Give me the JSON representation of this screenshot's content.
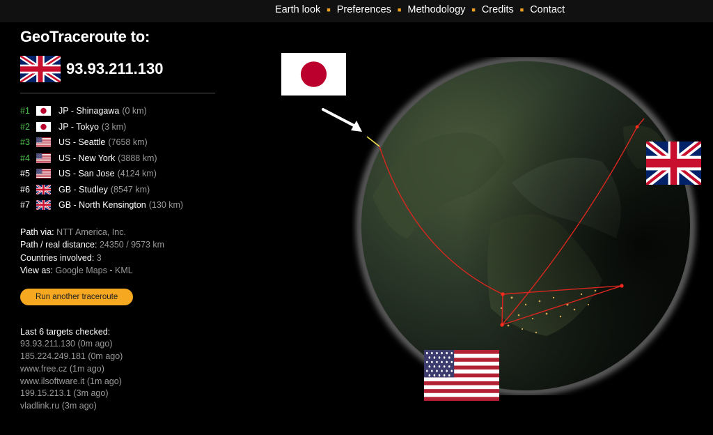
{
  "nav": {
    "items": [
      "Earth look",
      "Preferences",
      "Methodology",
      "Credits",
      "Contact"
    ],
    "separator_color": "#f0a01e"
  },
  "panel": {
    "title": "GeoTraceroute to:",
    "target_ip": "93.93.211.130",
    "target_flag": "gb-flag"
  },
  "hops": [
    {
      "num": "#1",
      "flag": "jp-flag",
      "label": "JP - Shinagawa",
      "dist": "(0 km)",
      "color": "green"
    },
    {
      "num": "#2",
      "flag": "jp-flag",
      "label": "JP - Tokyo",
      "dist": "(3 km)",
      "color": "green"
    },
    {
      "num": "#3",
      "flag": "us-flag",
      "label": "US - Seattle",
      "dist": "(7658 km)",
      "color": "green"
    },
    {
      "num": "#4",
      "flag": "us-flag",
      "label": "US - New York",
      "dist": "(3888 km)",
      "color": "green"
    },
    {
      "num": "#5",
      "flag": "us-flag",
      "label": "US - San Jose",
      "dist": "(4124 km)",
      "color": "white"
    },
    {
      "num": "#6",
      "flag": "gb-flag",
      "label": "GB - Studley",
      "dist": "(8547 km)",
      "color": "white"
    },
    {
      "num": "#7",
      "flag": "gb-flag",
      "label": "GB - North Kensington",
      "dist": "(130 km)",
      "color": "white"
    }
  ],
  "info": {
    "path_via_label": "Path via:",
    "path_via_value": "NTT America, Inc.",
    "distance_label": "Path / real distance:",
    "distance_value": "24350 / 9573 km",
    "countries_label": "Countries involved:",
    "countries_value": "3",
    "view_as_label": "View as:",
    "view_google": "Google Maps",
    "view_sep": "-",
    "view_kml": "KML"
  },
  "button": {
    "label": "Run another traceroute",
    "color": "#f6a821"
  },
  "last": {
    "title": "Last 6 targets checked:",
    "items": [
      "93.93.211.130 (0m ago)",
      "185.224.249.181 (0m ago)",
      "www.free.cz (1m ago)",
      "www.ilsoftware.it (1m ago)",
      "199.15.213.1 (3m ago)",
      "vladlink.ru (3m ago)"
    ]
  },
  "globe": {
    "flags": [
      "jp-flag",
      "gb-flag",
      "us-flag"
    ],
    "route_color": "#d8261e",
    "arrow_icon": "arrow-icon"
  }
}
